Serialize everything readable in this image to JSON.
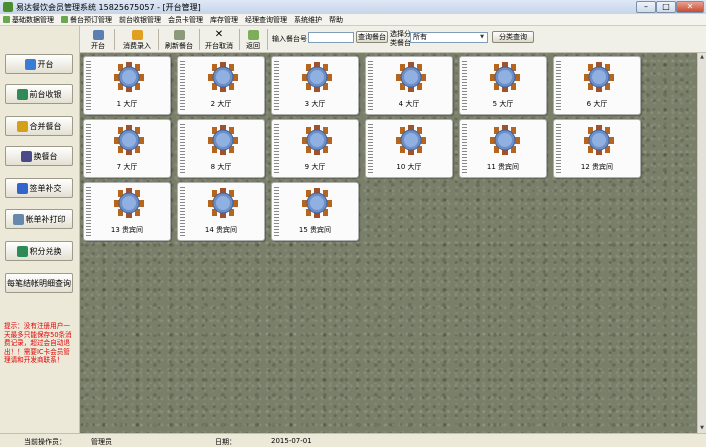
{
  "window": {
    "title": "易达餐饮会员管理系统 15825675057 - [开台管理]"
  },
  "menu": [
    {
      "label": "基础数据管理",
      "icon": "green"
    },
    {
      "label": "餐台预订管理",
      "icon": "green"
    },
    {
      "label": "前台收银管理",
      "icon": "none"
    },
    {
      "label": "会员卡管理",
      "icon": "none"
    },
    {
      "label": "库存管理",
      "icon": "none"
    },
    {
      "label": "经理查询管理",
      "icon": "none"
    },
    {
      "label": "系统维护",
      "icon": "none"
    },
    {
      "label": "帮助",
      "icon": "none"
    }
  ],
  "sidebar": {
    "buttons": [
      {
        "label": "开台",
        "color": "#3a7bd5"
      },
      {
        "label": "前台收银",
        "color": "#2e8b57"
      },
      {
        "label": "合并餐台",
        "color": "#d4a017"
      },
      {
        "label": "换餐台",
        "color": "#4a4a8a"
      },
      {
        "label": "签单补交",
        "color": "#3366cc"
      },
      {
        "label": "帐单补打印",
        "color": "#6688aa"
      },
      {
        "label": "积分兑换",
        "color": "#2e8b57"
      },
      {
        "label": "每笔结帐明细查询",
        "color": ""
      }
    ],
    "note": "提示：没有注册用户一天最多只能保存50条消费记录，超过会自动退出！！需要IC卡会员管理请和开发商联系！"
  },
  "toolbar": {
    "buttons": [
      {
        "label": "开台"
      },
      {
        "label": "消费录入"
      },
      {
        "label": "刷新餐台"
      },
      {
        "label": "开台取消"
      },
      {
        "label": "返回"
      }
    ],
    "table_no_label": "输入餐台号",
    "table_no_value": "",
    "query_table_button": "查询餐台",
    "category_label_line1": "选择分",
    "category_label_line2": "类餐台",
    "category_value": "所有",
    "category_query_button": "分类查询"
  },
  "tables": [
    {
      "label": "1 大厅"
    },
    {
      "label": "2 大厅"
    },
    {
      "label": "3 大厅"
    },
    {
      "label": "4 大厅"
    },
    {
      "label": "5 大厅"
    },
    {
      "label": "6 大厅"
    },
    {
      "label": "7 大厅"
    },
    {
      "label": "8 大厅"
    },
    {
      "label": "9 大厅"
    },
    {
      "label": "10 大厅"
    },
    {
      "label": "11 贵宾间"
    },
    {
      "label": "12 贵宾间"
    },
    {
      "label": "13 贵宾间"
    },
    {
      "label": "14 贵宾间"
    },
    {
      "label": "15 贵宾间"
    }
  ],
  "status": {
    "operator_label": "当前操作员：",
    "operator_value": "管理员",
    "date_label": "日期：",
    "date_value": "2015-07-01"
  }
}
